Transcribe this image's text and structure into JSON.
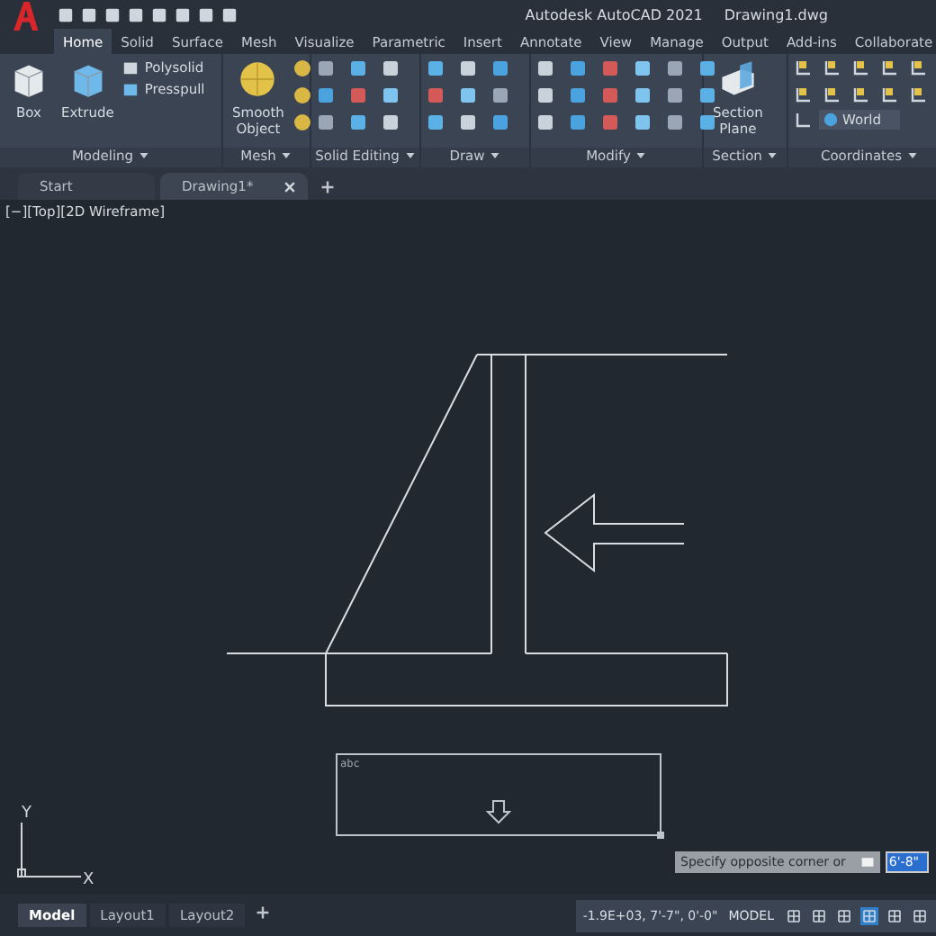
{
  "title_bar": {
    "app_title": "Autodesk AutoCAD 2021",
    "file_name": "Drawing1.dwg"
  },
  "ribbon_tabs": [
    {
      "label": "Home",
      "selected": true
    },
    {
      "label": "Solid",
      "selected": false
    },
    {
      "label": "Surface",
      "selected": false
    },
    {
      "label": "Mesh",
      "selected": false
    },
    {
      "label": "Visualize",
      "selected": false
    },
    {
      "label": "Parametric",
      "selected": false
    },
    {
      "label": "Insert",
      "selected": false
    },
    {
      "label": "Annotate",
      "selected": false
    },
    {
      "label": "View",
      "selected": false
    },
    {
      "label": "Manage",
      "selected": false
    },
    {
      "label": "Output",
      "selected": false
    },
    {
      "label": "Add-ins",
      "selected": false
    },
    {
      "label": "Collaborate",
      "selected": false
    }
  ],
  "ribbon_panels": [
    {
      "title": "Modeling",
      "kind": "modeling",
      "large_buttons": [
        "Box",
        "Extrude"
      ],
      "small_buttons": [
        "Polysolid",
        "Presspull"
      ]
    },
    {
      "title": "Mesh",
      "kind": "mesh",
      "large_buttons": [
        "Smooth\nObject"
      ]
    },
    {
      "title": "Solid Editing",
      "kind": "grid"
    },
    {
      "title": "Draw",
      "kind": "grid"
    },
    {
      "title": "Modify",
      "kind": "grid"
    },
    {
      "title": "Section",
      "kind": "section",
      "large_buttons": [
        "Section\nPlane"
      ]
    },
    {
      "title": "Coordinates",
      "kind": "coordinates",
      "dropdown": "World"
    }
  ],
  "doc_tabs": [
    {
      "label": "Start",
      "selected": false
    },
    {
      "label": "Drawing1*",
      "selected": true
    }
  ],
  "viewport_label": "[−][Top][2D Wireframe]",
  "text_box": {
    "placeholder": "abc"
  },
  "ucs_icon": {
    "x_label": "X",
    "y_label": "Y"
  },
  "prompt": {
    "text": "Specify opposite corner or",
    "value": "6'-8\""
  },
  "layout_tabs": [
    {
      "label": "Model",
      "selected": true
    },
    {
      "label": "Layout1",
      "selected": false
    },
    {
      "label": "Layout2",
      "selected": false
    }
  ],
  "status_bar": {
    "coordinates": "-1.9E+03, 7'-7\", 0'-0\"",
    "space": "MODEL"
  }
}
